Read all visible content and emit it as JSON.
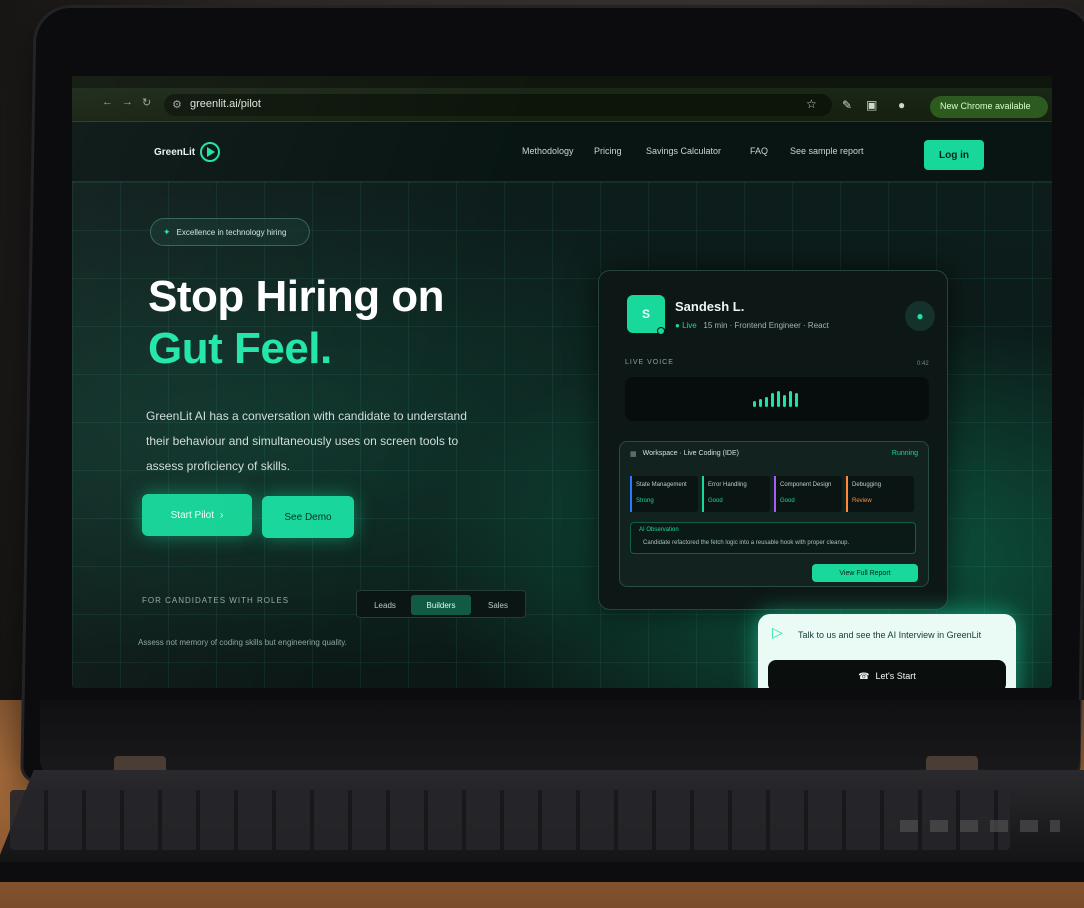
{
  "browser": {
    "url": "greenlit.ai/pilot",
    "update_label": "New Chrome available"
  },
  "site": {
    "logo_text": "GreenLit",
    "nav": [
      "Methodology",
      "Pricing",
      "Savings Calculator",
      "FAQ",
      "See sample report"
    ],
    "login_label": "Log in",
    "badge_text": "Excellence in technology hiring",
    "hero_title_line1": "Stop Hiring on",
    "hero_title_line2": "Gut Feel.",
    "hero_description": "GreenLit AI has a conversation with candidate to understand their behaviour and simultaneously uses on screen tools to assess proficiency of skills.",
    "primary_button": "Start Pilot",
    "secondary_button": "See Demo",
    "section_label": "FOR CANDIDATES WITH ROLES",
    "segments": [
      "Leads",
      "Builders",
      "Sales"
    ],
    "active_segment": 1,
    "footnote": "Assess not memory of coding skills but engineering quality."
  },
  "card": {
    "avatar_initial": "S",
    "candidate_name": "Sandesh L.",
    "status": "Live",
    "meta": "15 min · Frontend Engineer · React",
    "live_label": "LIVE VOICE",
    "live_time": "0:42",
    "ide_title": "Workspace · Live Coding (IDE)",
    "ide_status": "Running",
    "metrics": [
      {
        "label": "State Management",
        "value": "Strong",
        "color": "#2a7cff"
      },
      {
        "label": "Error Handling",
        "value": "Good",
        "color": "#19d89c"
      },
      {
        "label": "Component Design",
        "value": "Good",
        "color": "#a45cff"
      },
      {
        "label": "Debugging",
        "value": "Review",
        "color": "#ff8a3c"
      }
    ],
    "note_label": "AI Observation",
    "note_text": "Candidate refactored the fetch logic into a reusable hook with proper cleanup.",
    "ide_action": "View Full Report"
  },
  "popup": {
    "text": "Talk to us and see the AI Interview in GreenLit",
    "button": "Let's Start"
  }
}
